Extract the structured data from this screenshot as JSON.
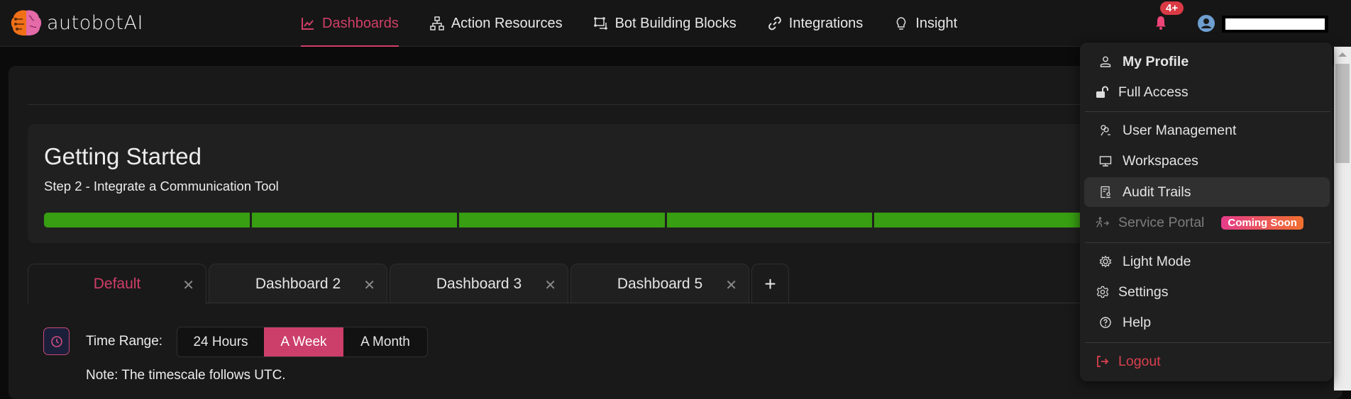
{
  "app": {
    "name": "autobotAI"
  },
  "nav": {
    "items": [
      {
        "label": "Dashboards",
        "icon": "chart-line-icon",
        "active": true
      },
      {
        "label": "Action Resources",
        "icon": "sitemap-icon",
        "active": false
      },
      {
        "label": "Bot Building Blocks",
        "icon": "blocks-icon",
        "active": false
      },
      {
        "label": "Integrations",
        "icon": "link-icon",
        "active": false
      },
      {
        "label": "Insight",
        "icon": "lightbulb-icon",
        "active": false
      }
    ]
  },
  "header": {
    "notification_count": "4+",
    "accent_color": "#d13f68"
  },
  "getting_started": {
    "title": "Getting Started",
    "step": "Step 2 - Integrate a Communication Tool",
    "progress_segments_filled": 5,
    "progress_color": "#389e12"
  },
  "tabs": [
    {
      "label": "Default",
      "active": true
    },
    {
      "label": "Dashboard 2",
      "active": false
    },
    {
      "label": "Dashboard 3",
      "active": false
    },
    {
      "label": "Dashboard 5",
      "active": false
    }
  ],
  "tab_close_glyph": "✕",
  "tab_add_glyph": "+",
  "time_range": {
    "label": "Time Range:",
    "options": [
      "24 Hours",
      "A Week",
      "A Month"
    ],
    "selected": "A Week",
    "note": "Note: The timescale follows UTC."
  },
  "user_menu": {
    "items": [
      {
        "label": "My Profile",
        "icon": "user-icon"
      },
      {
        "label": "Full Access",
        "icon": "unlock-icon"
      },
      {
        "label": "User Management",
        "icon": "users-icon"
      },
      {
        "label": "Workspaces",
        "icon": "monitor-icon"
      },
      {
        "label": "Audit Trails",
        "icon": "audit-icon"
      },
      {
        "label": "Service Portal",
        "icon": "walk-icon",
        "badge": "Coming Soon",
        "disabled": true
      },
      {
        "label": "Light Mode",
        "icon": "sun-gear-icon"
      },
      {
        "label": "Settings",
        "icon": "gear-icon"
      },
      {
        "label": "Help",
        "icon": "help-icon"
      },
      {
        "label": "Logout",
        "icon": "logout-icon"
      }
    ]
  }
}
